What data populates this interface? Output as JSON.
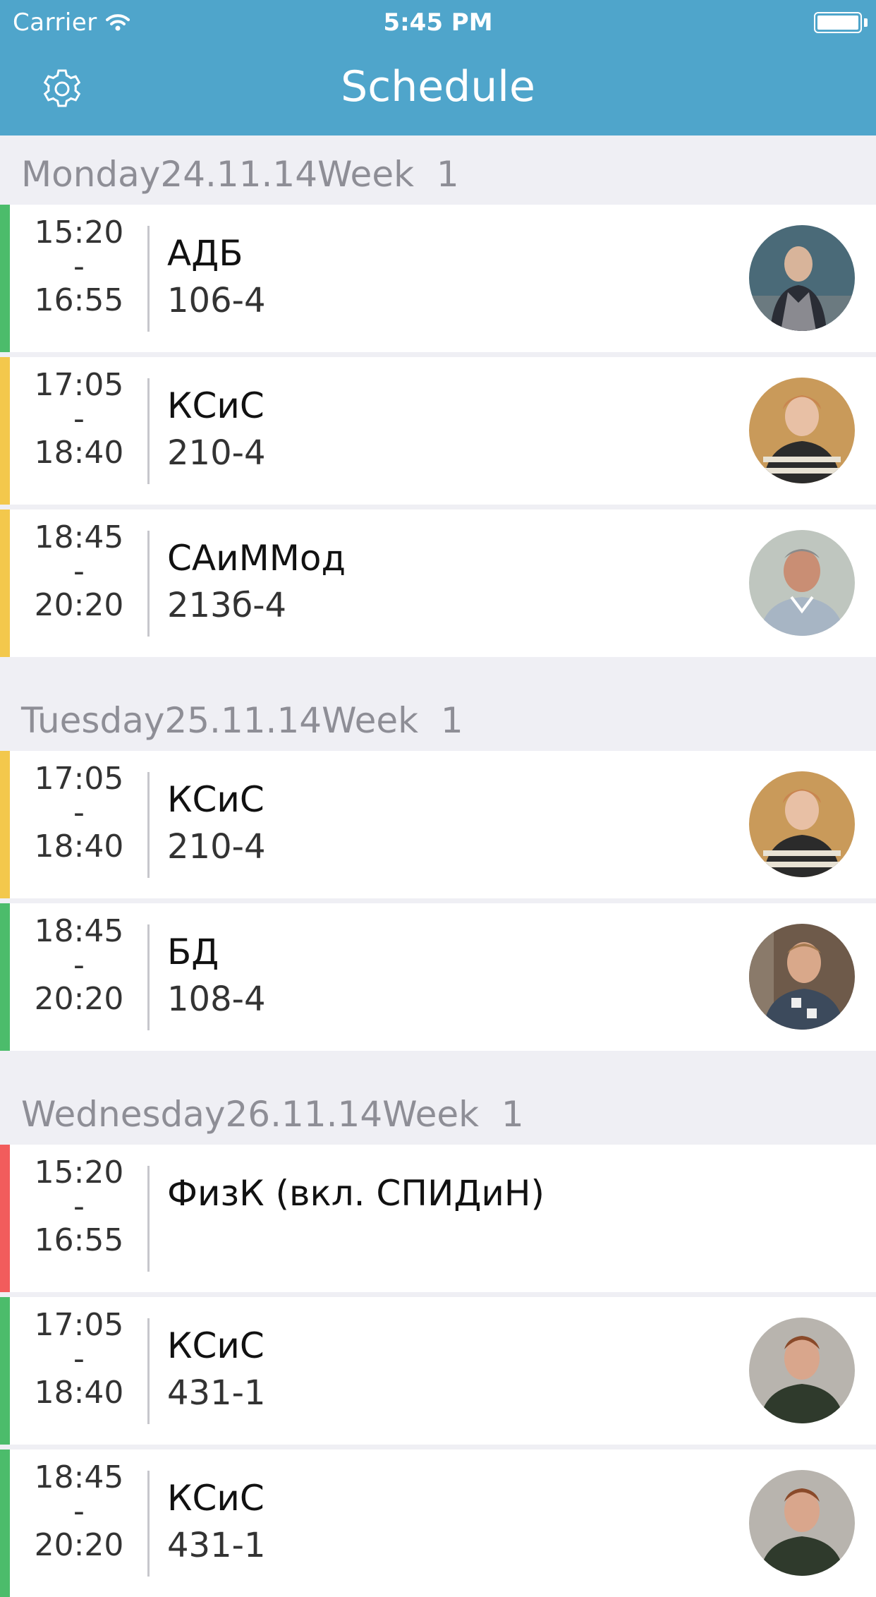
{
  "status_bar": {
    "carrier": "Carrier",
    "time": "5:45 PM"
  },
  "nav": {
    "title": "Schedule",
    "settings_icon": "gear-icon"
  },
  "colors": {
    "navbar": "#4fa5cb",
    "green": "#4cbc6b",
    "yellow": "#f3c84c",
    "red": "#f25c5c"
  },
  "days": [
    {
      "day": "Monday",
      "date": "24.11.14",
      "week": "Week  1",
      "lessons": [
        {
          "start": "15:20",
          "sep": "-",
          "end": "16:55",
          "subject": "АДБ",
          "room": "106-4",
          "color": "green",
          "avatar": "teacher-1"
        },
        {
          "start": "17:05",
          "sep": "-",
          "end": "18:40",
          "subject": "КСиС",
          "room": "210-4",
          "color": "yellow",
          "avatar": "teacher-2"
        },
        {
          "start": "18:45",
          "sep": "-",
          "end": "20:20",
          "subject": "САиММод",
          "room": "213б-4",
          "color": "yellow",
          "avatar": "teacher-3"
        }
      ]
    },
    {
      "day": "Tuesday",
      "date": "25.11.14",
      "week": "Week  1",
      "lessons": [
        {
          "start": "17:05",
          "sep": "-",
          "end": "18:40",
          "subject": "КСиС",
          "room": "210-4",
          "color": "yellow",
          "avatar": "teacher-2"
        },
        {
          "start": "18:45",
          "sep": "-",
          "end": "20:20",
          "subject": "БД",
          "room": "108-4",
          "color": "green",
          "avatar": "teacher-4"
        }
      ]
    },
    {
      "day": "Wednesday",
      "date": "26.11.14",
      "week": "Week  1",
      "lessons": [
        {
          "start": "15:20",
          "sep": "-",
          "end": "16:55",
          "subject": "ФизК (вкл. СПИДиН)",
          "room": "",
          "color": "red",
          "avatar": ""
        },
        {
          "start": "17:05",
          "sep": "-",
          "end": "18:40",
          "subject": "КСиС",
          "room": "431-1",
          "color": "green",
          "avatar": "teacher-5"
        },
        {
          "start": "18:45",
          "sep": "-",
          "end": "20:20",
          "subject": "КСиС",
          "room": "431-1",
          "color": "green",
          "avatar": "teacher-5"
        }
      ]
    }
  ]
}
